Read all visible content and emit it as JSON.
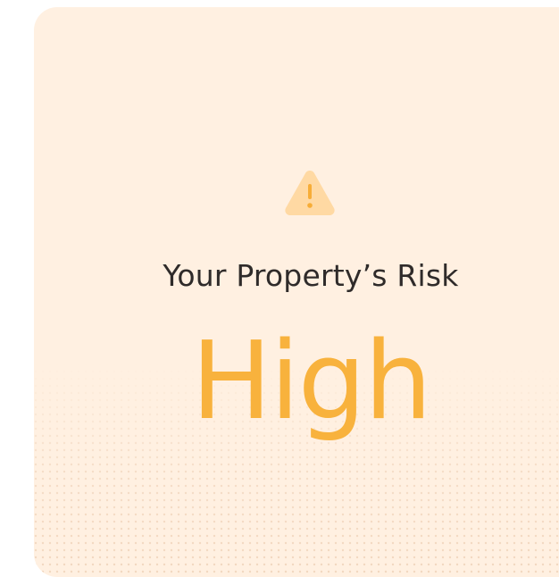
{
  "card": {
    "background": "#fff0e1",
    "accent": "#f8b23d"
  },
  "risk": {
    "title": "Your Property’s Risk",
    "level": "High",
    "icon": "warning-triangle-icon"
  }
}
